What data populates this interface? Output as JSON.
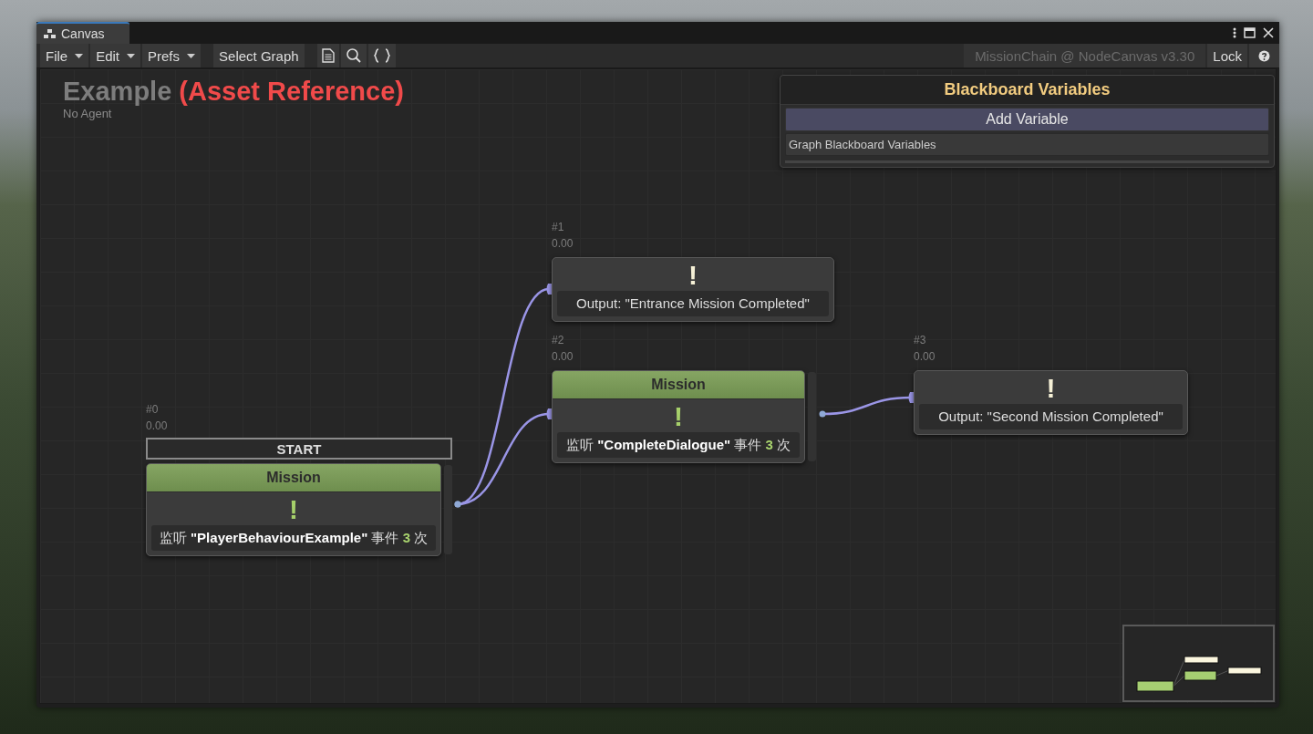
{
  "window": {
    "tab": "Canvas"
  },
  "toolbar": {
    "menus": [
      {
        "label": "File"
      },
      {
        "label": "Edit"
      },
      {
        "label": "Prefs"
      }
    ],
    "select_graph": "Select Graph",
    "graph_info": "MissionChain @ NodeCanvas v3.30",
    "lock": "Lock"
  },
  "graph": {
    "title": "Example",
    "reference": "(Asset Reference)",
    "agent": "No Agent"
  },
  "blackboard": {
    "title": "Blackboard Variables",
    "add_button": "Add Variable",
    "section": "Graph Blackboard Variables"
  },
  "nodes": [
    {
      "id_label": "#0",
      "time": "0.00",
      "start_label": "START",
      "kind": "mission",
      "header": "Mission",
      "icon": "!",
      "description": {
        "prefix": "监听",
        "target": "\"PlayerBehaviourExample\"",
        "event": "事件",
        "count": "3",
        "suffix": "次"
      }
    },
    {
      "id_label": "#1",
      "time": "0.00",
      "kind": "output",
      "icon": "!",
      "text": "Output: \"Entrance Mission Completed\""
    },
    {
      "id_label": "#2",
      "time": "0.00",
      "kind": "mission",
      "header": "Mission",
      "icon": "!",
      "description": {
        "prefix": "监听",
        "target": "\"CompleteDialogue\"",
        "event": "事件",
        "count": "3",
        "suffix": "次"
      }
    },
    {
      "id_label": "#3",
      "time": "0.00",
      "kind": "output",
      "icon": "!",
      "text": "Output: \"Second Mission Completed\""
    }
  ]
}
